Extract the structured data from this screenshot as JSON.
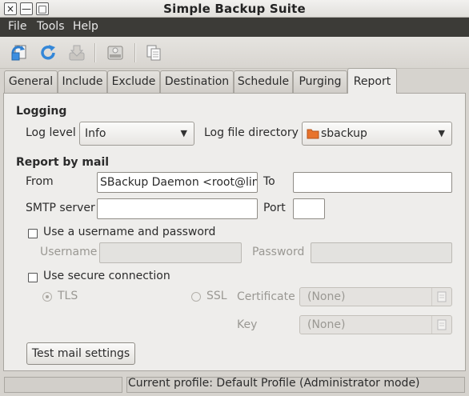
{
  "window": {
    "title": "Simple Backup Suite",
    "controls": {
      "close": "×",
      "minimize": "—",
      "maximize": "□"
    }
  },
  "menu": [
    "File",
    "Tools",
    "Help"
  ],
  "toolbar": {
    "icons": [
      "save-config-icon",
      "refresh-icon",
      "backup-download-icon",
      "disk-icon",
      "copy-icon"
    ]
  },
  "tabs": [
    "General",
    "Include",
    "Exclude",
    "Destination",
    "Schedule",
    "Purging",
    "Report"
  ],
  "active_tab": "Report",
  "logging": {
    "heading": "Logging",
    "level_label": "Log level",
    "level_value": "Info",
    "dir_label": "Log file directory",
    "dir_value": "sbackup"
  },
  "mail": {
    "heading": "Report by mail",
    "from_label": "From",
    "from_value": "SBackup Daemon <root@linu",
    "to_label": "To",
    "to_value": "",
    "smtp_label": "SMTP server",
    "smtp_value": "",
    "port_label": "Port",
    "port_value": "",
    "auth_check_label": "Use a username and password",
    "username_label": "Username",
    "password_label": "Password",
    "secure_check_label": "Use secure connection",
    "tls_label": "TLS",
    "ssl_label": "SSL",
    "certificate_label": "Certificate",
    "certificate_value": "(None)",
    "key_label": "Key",
    "key_value": "(None)",
    "test_button": "Test mail settings"
  },
  "status": {
    "text": "Current profile: Default Profile  (Administrator mode)"
  },
  "colors": {
    "menubar": "#3c3b37",
    "folder": "#e8732c",
    "window_bg": "#d6d3ce"
  }
}
